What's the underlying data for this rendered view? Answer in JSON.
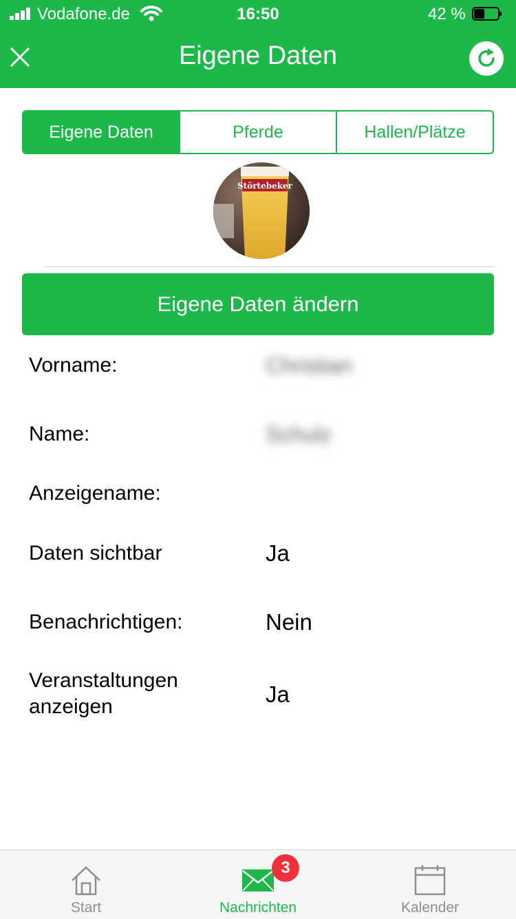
{
  "status_bar": {
    "carrier": "Vodafone.de",
    "time": "16:50",
    "battery": "42 %"
  },
  "header": {
    "title": "Eigene Daten",
    "close_icon": "close-icon",
    "refresh_icon": "refresh-icon"
  },
  "segments": [
    {
      "label": "Eigene Daten",
      "active": true
    },
    {
      "label": "Pferde",
      "active": false
    },
    {
      "label": "Hallen/Plätze",
      "active": false
    }
  ],
  "profile": {
    "avatar_caption": "Störtebeker",
    "edit_button": "Eigene Daten ändern"
  },
  "fields": [
    {
      "label": "Vorname:",
      "value": "Christian",
      "blurred": true
    },
    {
      "label": "Name:",
      "value": "Schulz",
      "blurred": true
    },
    {
      "label": "Anzeigename:",
      "value": ""
    },
    {
      "label": "Daten sichtbar",
      "value": "Ja"
    },
    {
      "label": "Benachrichtigen:",
      "value": "Nein"
    },
    {
      "label": "Veranstaltungen anzeigen",
      "value": "Ja"
    }
  ],
  "tabbar": {
    "items": [
      {
        "label": "Start",
        "icon": "home-icon"
      },
      {
        "label": "Nachrichten",
        "icon": "mail-icon",
        "badge": "3",
        "active": true
      },
      {
        "label": "Kalender",
        "icon": "calendar-icon"
      }
    ]
  },
  "colors": {
    "accent": "#1db84a",
    "badge": "#f0303a"
  }
}
